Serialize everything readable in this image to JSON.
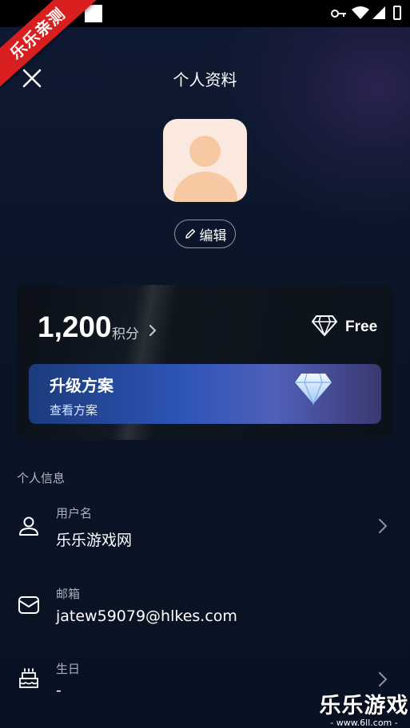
{
  "watermark": {
    "ribbon_text": "乐乐亲测",
    "corner_main": "乐乐游戏",
    "corner_sub": "- www.6ll.com -"
  },
  "header": {
    "title": "个人资料"
  },
  "profile": {
    "edit_label": "编辑"
  },
  "points_card": {
    "points_value": "1,200",
    "points_label": "积分",
    "plan_name": "Free",
    "upgrade_title": "升级方案",
    "upgrade_subtitle": "查看方案"
  },
  "personal_info": {
    "section_title": "个人信息",
    "fields": [
      {
        "label": "用户名",
        "value": "乐乐游戏网",
        "icon": "user-icon"
      },
      {
        "label": "邮箱",
        "value": "jatew59079@hlkes.com",
        "icon": "mail-icon"
      },
      {
        "label": "生日",
        "value": "-",
        "icon": "cake-icon"
      }
    ]
  },
  "colors": {
    "background": "#0b1324",
    "avatar_bg": "#fbe9df",
    "avatar_figure": "#f6c9a3",
    "upgrade_gradient_start": "#1b3b7c",
    "upgrade_gradient_end": "#5060b8",
    "ribbon": "#d81e1e"
  }
}
